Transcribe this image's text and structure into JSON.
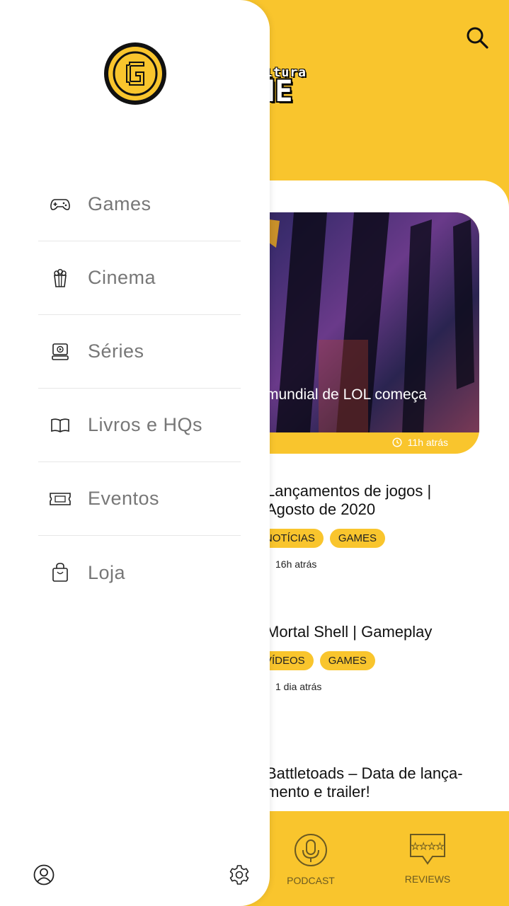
{
  "brand": {
    "small": "ultura",
    "big": "ME"
  },
  "drawer": {
    "menu": [
      {
        "label": "Games",
        "icon": "gamepad-icon"
      },
      {
        "label": "Cinema",
        "icon": "popcorn-icon"
      },
      {
        "label": "Séries",
        "icon": "tv-icon"
      },
      {
        "label": "Livros e HQs",
        "icon": "book-icon"
      },
      {
        "label": "Eventos",
        "icon": "ticket-icon"
      },
      {
        "label": "Loja",
        "icon": "shopping-bag-icon"
      }
    ]
  },
  "featured": {
    "title": "mundial de LOL começa",
    "time": "11h atrás"
  },
  "articles": [
    {
      "title_lines": [
        "Lançamentos de jogos |",
        "Agosto de 2020"
      ],
      "tags": [
        "NOTÍCIAS",
        "GAMES"
      ],
      "time": "16h atrás"
    },
    {
      "title_lines": [
        "Mortal Shell | Gameplay"
      ],
      "tags": [
        "VÍDEOS",
        "GAMES"
      ],
      "time": "1 dia atrás"
    },
    {
      "title_lines": [
        "Battletoads – Data de lança-",
        "mento e trailer!"
      ]
    }
  ],
  "bottom_nav": {
    "podcast": "PODCAST",
    "reviews": "REVIEWS"
  },
  "colors": {
    "accent": "#f9c52d",
    "text": "#111111",
    "menu_text": "#777777"
  }
}
